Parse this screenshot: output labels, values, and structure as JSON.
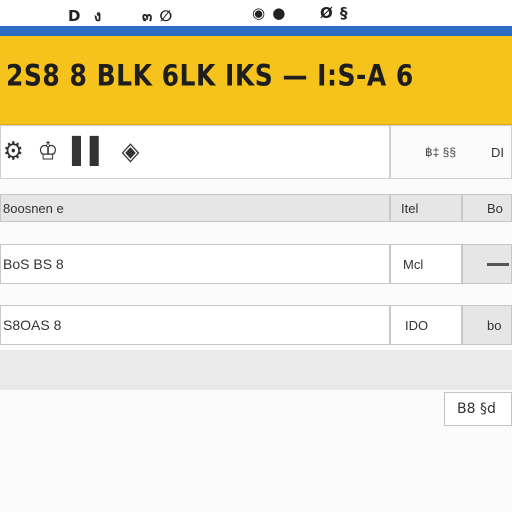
{
  "topbar": {
    "items": [
      "D  ง",
      "๓ ∅",
      "◉ ●",
      "Ø §"
    ]
  },
  "banner": {
    "title": "2S8 8 BLK 6LK  IKS — I:S-A 6",
    "bg_color": "#f6c21c"
  },
  "toolbar": {
    "icons": [
      "settings-icon",
      "pin-icon",
      "chart-icon",
      "grid-icon"
    ],
    "icon_glyphs": [
      "⚙",
      "♔",
      "▌▌",
      "◈"
    ],
    "right_label_1": "฿‡ §§",
    "right_label_2": "DI"
  },
  "rows": [
    {
      "label": "8oosnen e",
      "mid": "Itel",
      "end": "Bo"
    },
    {
      "label": "BoS BS 8",
      "mid": "Mcl",
      "end_icon": "minus-icon"
    },
    {
      "label": "S8OAS 8",
      "mid": "IDO",
      "end": "bo"
    }
  ],
  "bottom_button": {
    "label": "B8 §d"
  },
  "colors": {
    "accent_yellow": "#f6c21c",
    "accent_blue": "#2c6cc2"
  }
}
